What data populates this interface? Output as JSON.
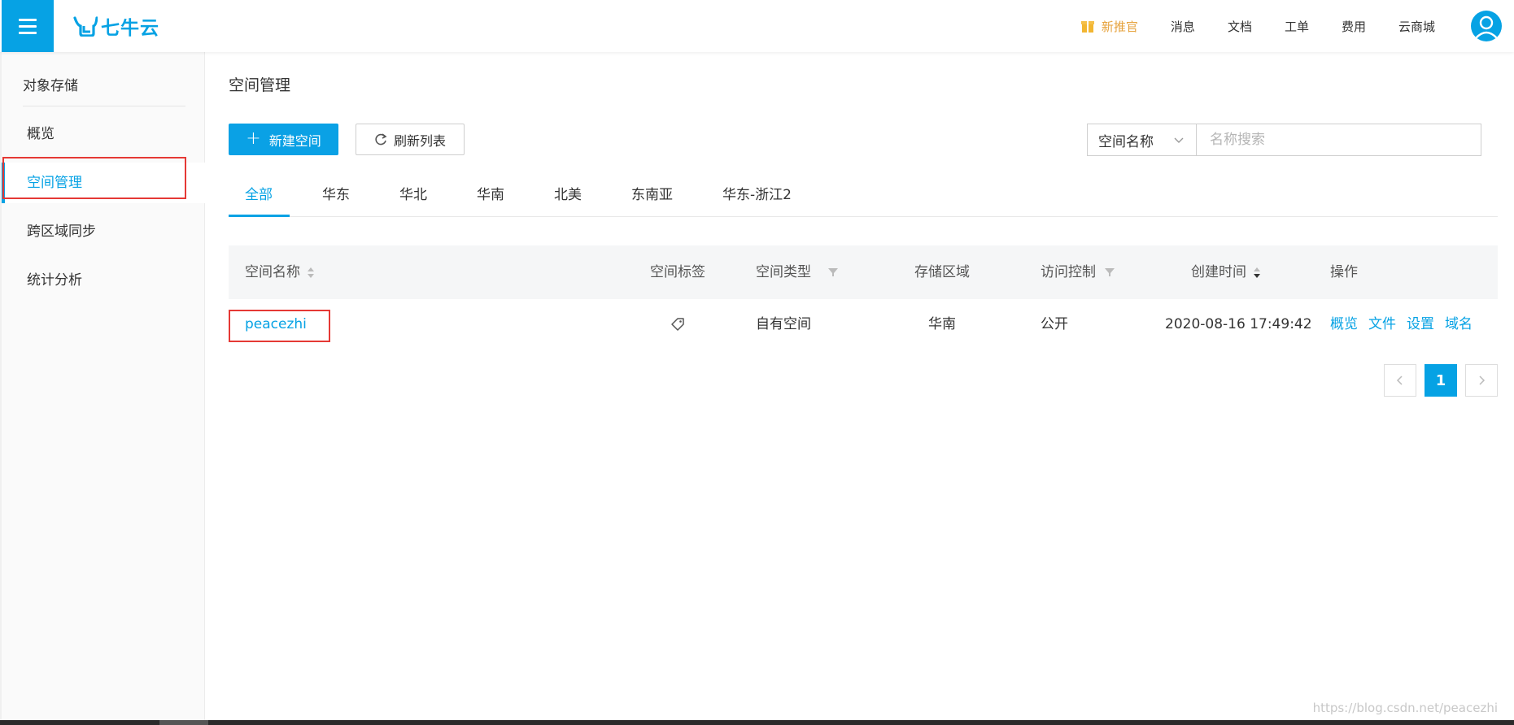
{
  "header": {
    "logo_text": "七牛云",
    "nav": [
      {
        "label": "新推官",
        "icon": "gift-icon"
      },
      {
        "label": "消息"
      },
      {
        "label": "文档"
      },
      {
        "label": "工单"
      },
      {
        "label": "费用"
      },
      {
        "label": "云商城"
      }
    ]
  },
  "sidebar": {
    "title": "对象存储",
    "items": [
      {
        "label": "概览"
      },
      {
        "label": "空间管理",
        "active": true
      },
      {
        "label": "跨区域同步"
      },
      {
        "label": "统计分析"
      }
    ]
  },
  "main": {
    "title": "空间管理",
    "new_button": "新建空间",
    "refresh_button": "刷新列表",
    "search": {
      "field_selected": "空间名称",
      "placeholder": "名称搜索"
    },
    "tabs": [
      {
        "label": "全部",
        "active": true
      },
      {
        "label": "华东"
      },
      {
        "label": "华北"
      },
      {
        "label": "华南"
      },
      {
        "label": "北美"
      },
      {
        "label": "东南亚"
      },
      {
        "label": "华东-浙江2"
      }
    ],
    "table": {
      "columns": {
        "name": "空间名称",
        "tag": "空间标签",
        "type": "空间类型",
        "region": "存储区域",
        "access": "访问控制",
        "created": "创建时间",
        "ops": "操作"
      },
      "rows": [
        {
          "name": "peacezhi",
          "type": "自有空间",
          "region": "华南",
          "access": "公开",
          "created": "2020-08-16 17:49:42",
          "ops": [
            "概览",
            "文件",
            "设置",
            "域名"
          ]
        }
      ]
    },
    "pagination": {
      "current": "1"
    }
  },
  "watermark": "https://blog.csdn.net/peacezhi",
  "colors": {
    "accent": "#06a2e4",
    "highlight": "#e53935",
    "promo": "#e6a23c"
  }
}
